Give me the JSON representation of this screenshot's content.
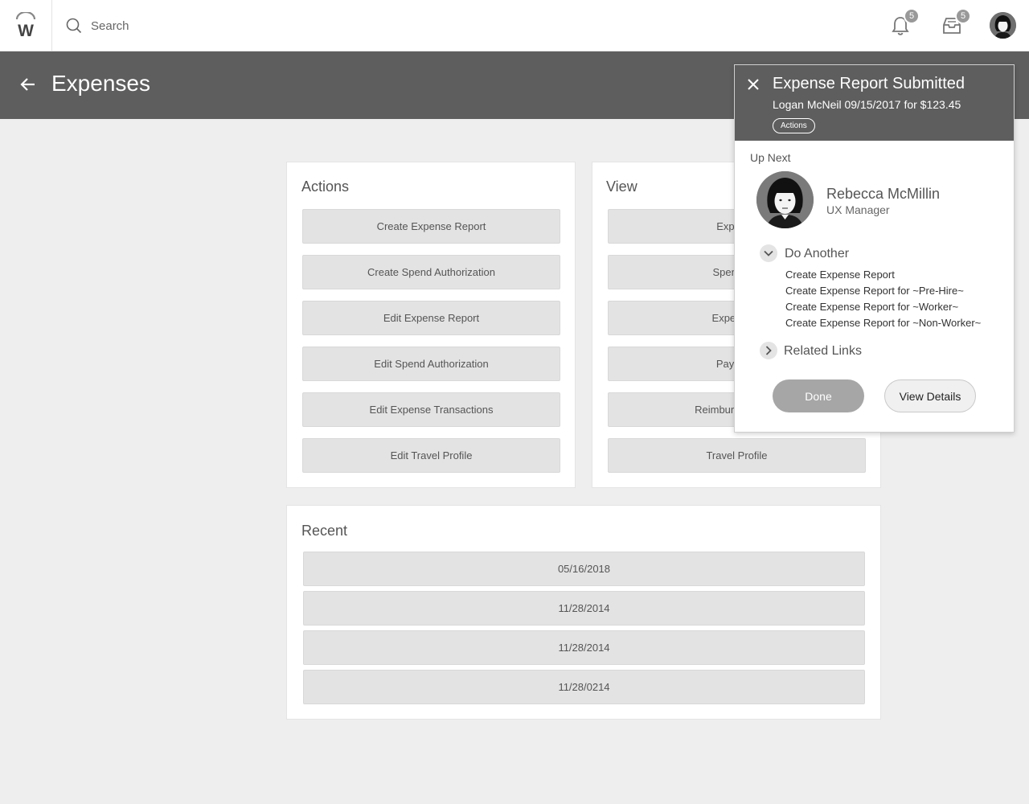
{
  "topbar": {
    "logo_letter": "W",
    "search_placeholder": "Search",
    "notifications_count": "5",
    "inbox_count": "5",
    "icons": {
      "search": "search-icon",
      "notifications": "bell-icon",
      "inbox": "inbox-icon",
      "profile": "avatar"
    }
  },
  "header": {
    "title": "Expenses",
    "back_icon": "arrow-left-icon"
  },
  "actions": {
    "title": "Actions",
    "buttons": [
      "Create Expense Report",
      "Create Spend Authorization",
      "Edit Expense Report",
      "Edit Spend Authorization",
      "Edit Expense Transactions",
      "Edit Travel Profile"
    ]
  },
  "view": {
    "title": "View",
    "buttons": [
      "Expense",
      "Spend Aut",
      "Expense T",
      "Payment",
      "Reimbursable Allo",
      "Travel Profile"
    ]
  },
  "recent": {
    "title": "Recent",
    "items": [
      "05/16/2018",
      "11/28/2014",
      "11/28/2014",
      "11/28/0214"
    ]
  },
  "popup": {
    "title": "Expense Report Submitted",
    "subtitle": "Logan McNeil 09/15/2017 for $123.45",
    "pill": "Actions",
    "up_next_label": "Up Next",
    "person": {
      "name": "Rebecca McMillin",
      "role": "UX Manager"
    },
    "do_another": {
      "label": "Do Another",
      "links": [
        "Create Expense Report",
        "Create Expense Report for ~Pre-Hire~",
        "Create Expense Report for ~Worker~",
        "Create Expense Report for ~Non-Worker~"
      ]
    },
    "related_links_label": "Related Links",
    "done_label": "Done",
    "view_details_label": "View Details"
  },
  "colors": {
    "header_bg": "#5e5e5e",
    "page_bg": "#eeeeee",
    "button_bg": "#e3e3e3",
    "done_bg": "#a6a6a6"
  }
}
